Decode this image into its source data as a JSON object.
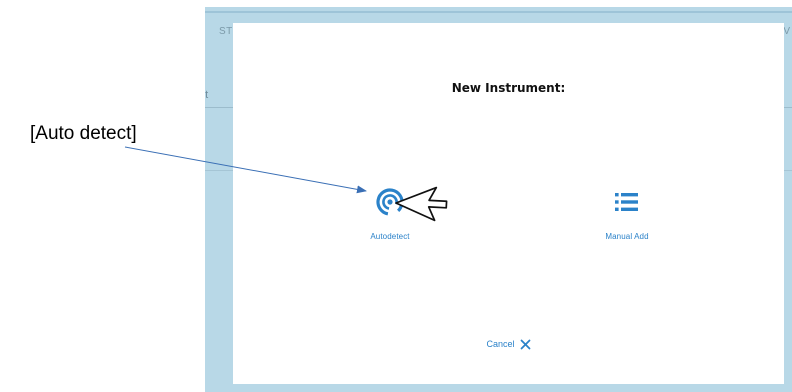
{
  "background_app": {
    "tab_left": "ST",
    "tab_right": "V",
    "section_label": "nt"
  },
  "dialog": {
    "title": "New Instrument:",
    "options": [
      {
        "label": "Autodetect",
        "icon": "radar-icon"
      },
      {
        "label": "Manual Add",
        "icon": "list-icon"
      }
    ],
    "cancel_label": "Cancel",
    "cancel_icon": "close-icon"
  },
  "annotation": {
    "text": "[Auto detect]"
  },
  "colors": {
    "accent": "#2b82c9",
    "background_app": "#b8d8e7",
    "arrow": "#3a6fb5"
  }
}
